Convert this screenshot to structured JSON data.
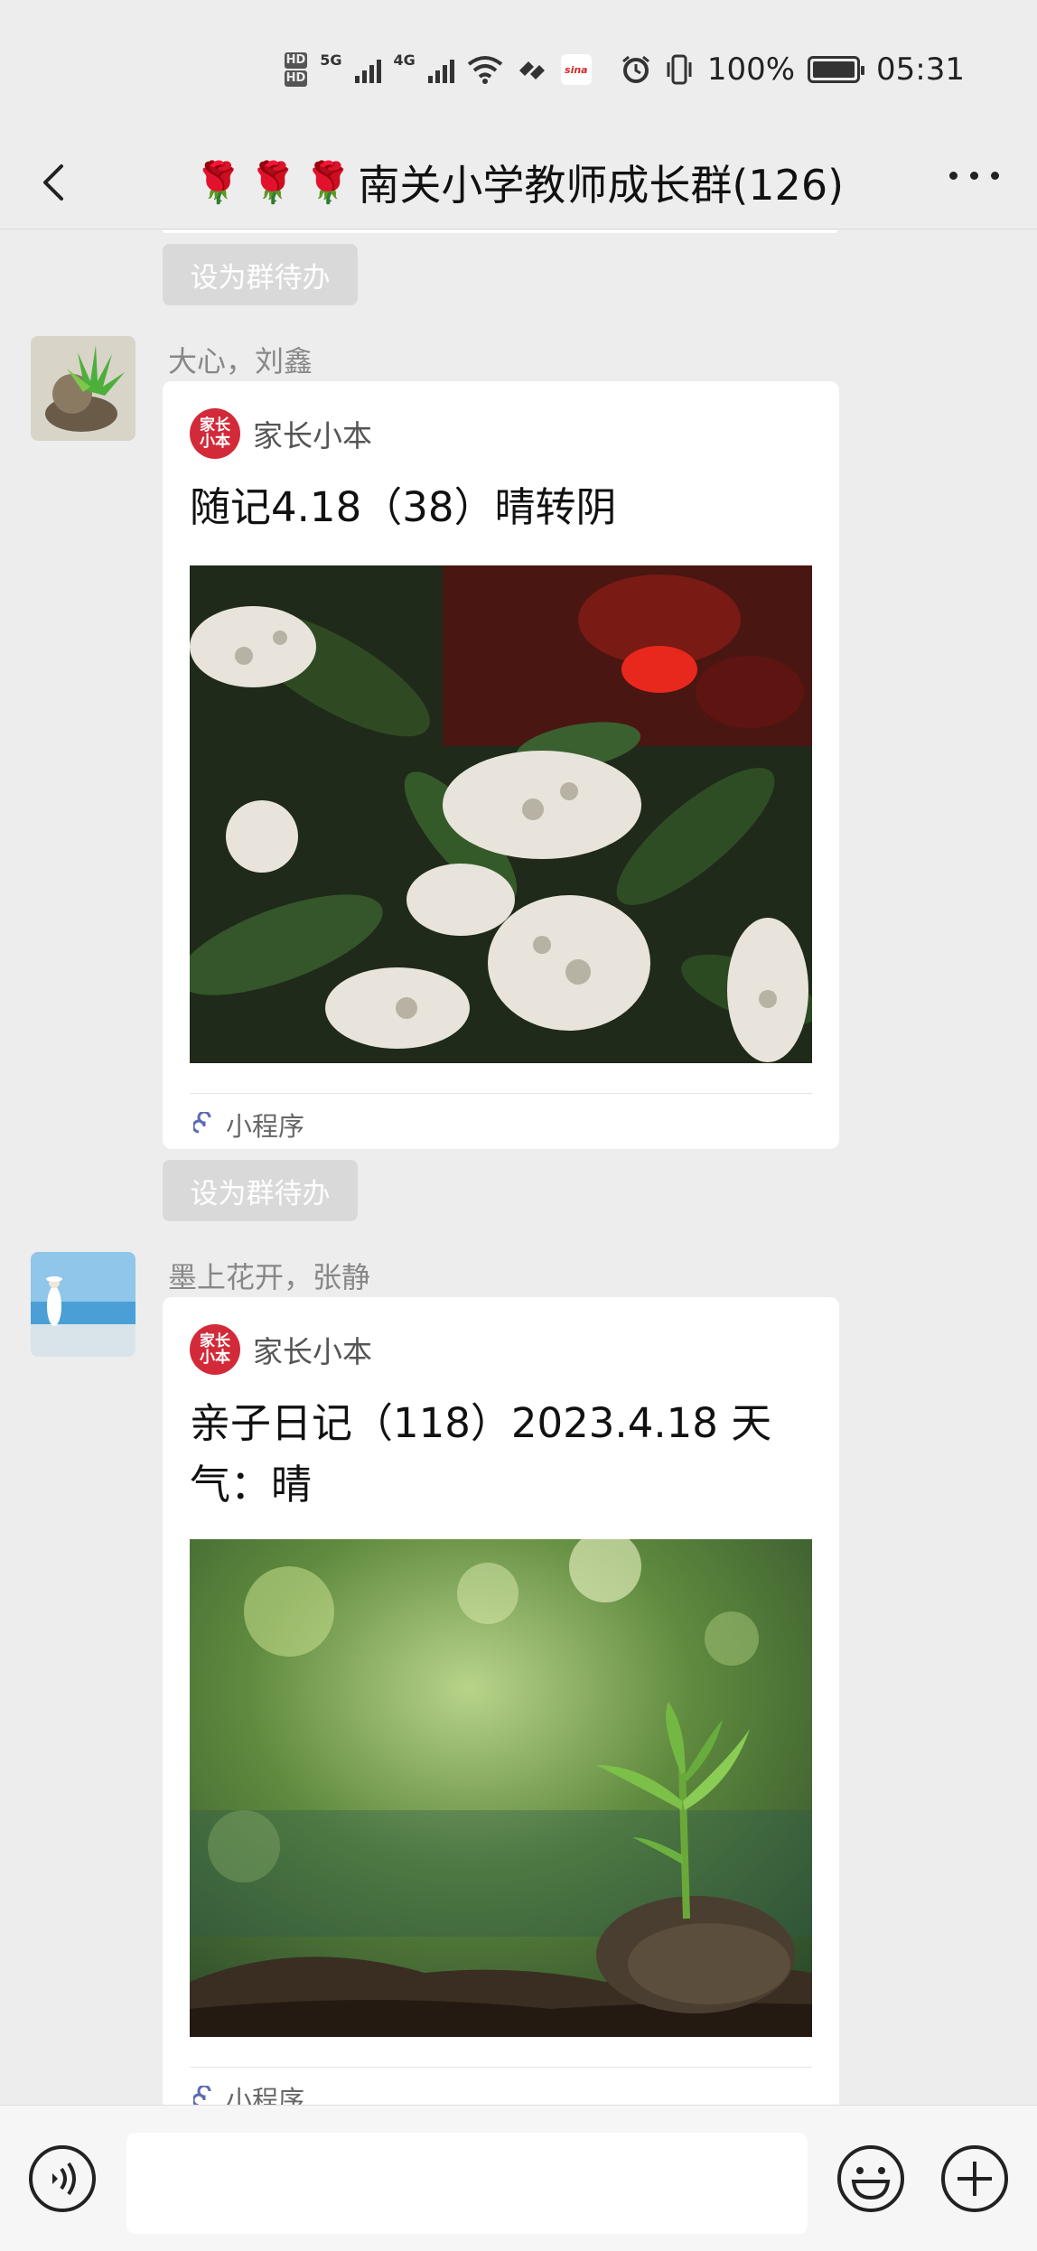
{
  "status_bar": {
    "network": "5G",
    "network2": "4G",
    "hd": "HD",
    "sina": "sina",
    "battery": "100%",
    "time": "05:31"
  },
  "header": {
    "title": "南关小学教师成长群(126)",
    "rose_icon": "🌹"
  },
  "chat": {
    "todo_label": "设为群待办",
    "messages": [
      {
        "sender": "大心，刘鑫",
        "app_name": "家长小本",
        "app_logo": "家长小本",
        "title": "随记4.18（38）晴转阴",
        "footer": "小程序"
      },
      {
        "sender": "墨上花开，张静",
        "app_name": "家长小本",
        "app_logo": "家长小本",
        "title": "亲子日记（118）2023.4.18 天气：晴",
        "footer": "小程序"
      }
    ]
  },
  "input_bar": {
    "voice_icon": "voice-icon",
    "emoji_icon": "emoji-icon",
    "plus_icon": "plus-icon"
  }
}
